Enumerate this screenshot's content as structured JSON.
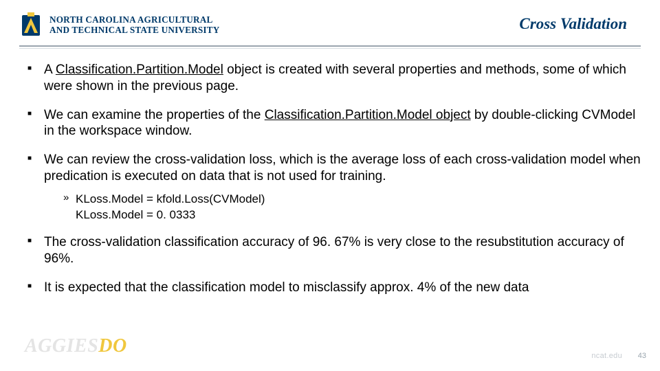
{
  "header": {
    "institution_line1": "NORTH CAROLINA AGRICULTURAL",
    "institution_line2": "AND TECHNICAL STATE UNIVERSITY",
    "title": "Cross Validation"
  },
  "bullets": {
    "b1_pre": "A ",
    "b1_u": "Classification.Partition.Model",
    "b1_post": " object is created with several properties and methods, some of which were shown in the previous page.",
    "b2_pre": "We can examine the properties of the ",
    "b2_u": "Classification.Partition.Model object",
    "b2_post": "  by double-clicking CVModel in the workspace window.",
    "b3": "We can review the cross-validation loss, which is the average loss of each cross-validation model when predication is executed on data that is not used for training.",
    "b3_sub1": "KLoss.Model = kfold.Loss(CVModel)",
    "b3_sub2": "KLoss.Model = 0. 0333",
    "b4": "The cross-validation classification accuracy of 96. 67% is very close to the resubstitution accuracy of 96%.",
    "b5": "It is expected that the classification model to misclassify approx. 4% of the new data"
  },
  "footer": {
    "watermark_a": "AGGIES",
    "watermark_b": "DO",
    "page": "43",
    "url": "ncat.edu"
  }
}
